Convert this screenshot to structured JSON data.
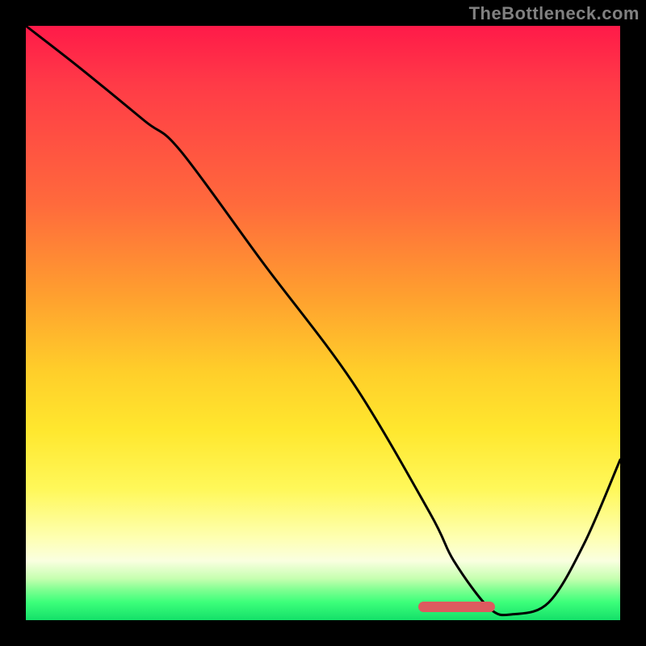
{
  "watermark": "TheBottleneck.com",
  "chart_data": {
    "type": "line",
    "title": "",
    "xlabel": "",
    "ylabel": "",
    "xlim": [
      0,
      100
    ],
    "ylim": [
      0,
      100
    ],
    "grid": false,
    "legend": false,
    "background_gradient": {
      "direction": "vertical",
      "stops": [
        {
          "pos": 0,
          "color": "#ff1a49"
        },
        {
          "pos": 30,
          "color": "#ff6a3c"
        },
        {
          "pos": 58,
          "color": "#ffce2a"
        },
        {
          "pos": 78,
          "color": "#fff85a"
        },
        {
          "pos": 90,
          "color": "#faffe0"
        },
        {
          "pos": 100,
          "color": "#14e069"
        }
      ]
    },
    "series": [
      {
        "name": "bottleneck-curve",
        "color": "#000000",
        "x": [
          0,
          9,
          20,
          26,
          40,
          55,
          68,
          72,
          78,
          82,
          88,
          94,
          100
        ],
        "values": [
          100,
          93,
          84,
          79,
          60,
          40,
          18,
          10,
          2,
          1,
          3,
          13,
          27
        ]
      }
    ],
    "marker": {
      "name": "optimal-range",
      "color": "#dd5a5f",
      "x_start": 66,
      "x_end": 79,
      "y": 1.4
    }
  }
}
